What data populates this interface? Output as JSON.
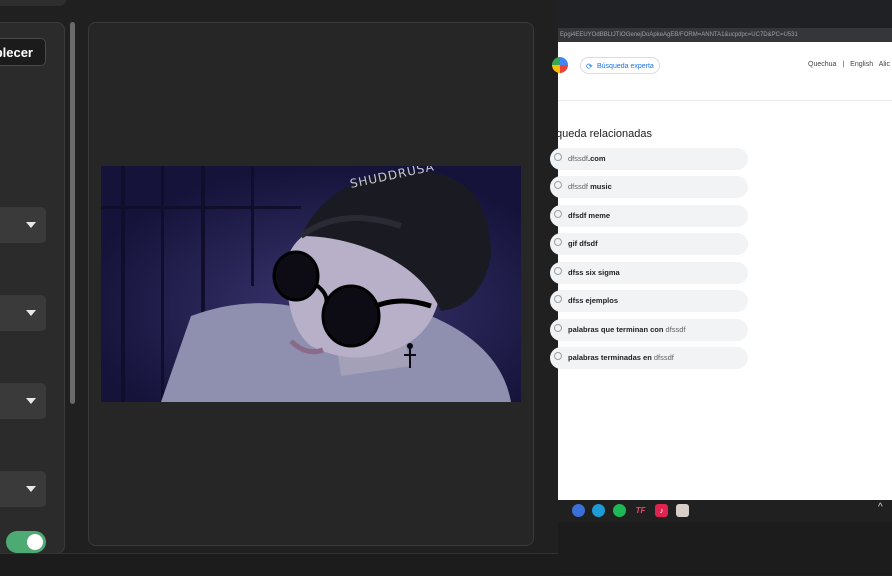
{
  "settings": {
    "apply_label": "blecer",
    "toggle_on": true
  },
  "browser": {
    "address_url": "Epgi4EEUYOdBBLtJTIOGenejDoApkeAgEB/FORM=ANNTA1&ucpdpc=UC7D&PC=U531",
    "expert_search_label": "Búsqueda experta",
    "languages": [
      "Quechua",
      "|",
      "English",
      "Alic"
    ],
    "related_title": "queda relacionadas",
    "related_searches": [
      {
        "plain": "dfssdf",
        "bold": ".com",
        "order": "plain-first"
      },
      {
        "plain": "dfssdf",
        "bold": " music",
        "order": "plain-first"
      },
      {
        "plain": "",
        "bold": "dfsdf meme",
        "order": "bold-first"
      },
      {
        "plain": "",
        "bold": "gif dfsdf",
        "order": "bold-first"
      },
      {
        "plain": "",
        "bold": "dfss six sigma",
        "order": "bold-first"
      },
      {
        "plain": "",
        "bold": "dfss ejemplos",
        "order": "bold-first"
      },
      {
        "plain": "dfssdf",
        "bold": "palabras que terminan con ",
        "order": "bold-first"
      },
      {
        "plain": "dfssdf",
        "bold": "palabras terminadas en ",
        "order": "bold-first"
      }
    ]
  },
  "taskbar": {
    "icons": [
      "copilot-icon",
      "edge-icon",
      "spotify-icon",
      "tf-icon",
      "tiktok-icon",
      "app-icon"
    ],
    "tf_label": "TF",
    "tray_chevron": "^"
  },
  "colors": {
    "toggle_on": "#4caa72",
    "link_blue": "#1a73e8"
  }
}
